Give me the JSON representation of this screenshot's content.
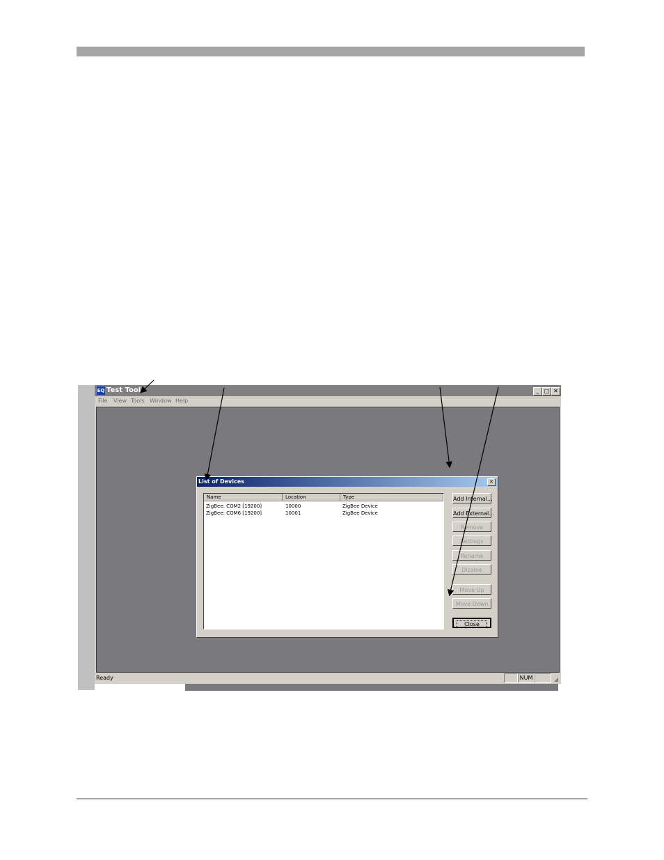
{
  "app": {
    "icon_label": "EQ",
    "title": "Test Tool",
    "minimize": "_",
    "maximize": "□",
    "close": "✕"
  },
  "menu": [
    "File",
    "View",
    "Tools",
    "Window",
    "Help"
  ],
  "status": {
    "ready": "Ready",
    "num": "NUM"
  },
  "dialog": {
    "title": "List of Devices",
    "close": "✕",
    "columns": [
      "Name",
      "Location",
      "Type"
    ],
    "rows": [
      {
        "name": "ZigBee: COM2 [19200]",
        "location": "10000",
        "type": "ZigBee Device"
      },
      {
        "name": "ZigBee: COM6 [19200]",
        "location": "10001",
        "type": "ZigBee Device"
      }
    ],
    "buttons": {
      "add_internal": "Add Internal...",
      "add_external": "Add External...",
      "remove": "Remove",
      "settings": "Settings",
      "rename": "Rename",
      "disable": "Disable",
      "move_up": "Move Up",
      "move_down": "Move Down",
      "close": "Close"
    }
  },
  "colors": {
    "desktop": "#7a7a7e",
    "window_face": "#d4d0c8",
    "title_gradient_start": "#0a246a",
    "title_gradient_end": "#a6caf0"
  }
}
